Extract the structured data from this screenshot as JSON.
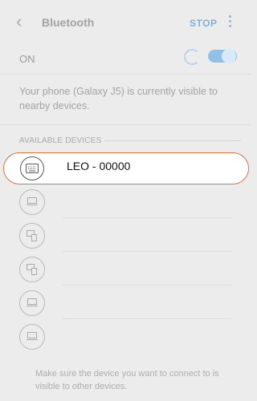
{
  "header": {
    "back_icon": "chevron-left-icon",
    "title": "Bluetooth",
    "stop_label": "STOP",
    "more_icon": "more-vertical-icon"
  },
  "status": {
    "label": "ON",
    "scanning": true,
    "toggle_on": true
  },
  "visibility_text": "Your phone (Galaxy J5) is currently visible to nearby devices.",
  "section_label": "AVAILABLE DEVICES",
  "devices": [
    {
      "name": "LEO - 00000",
      "icon": "keyboard-icon",
      "highlighted": true
    },
    {
      "name": "",
      "icon": "laptop-icon"
    },
    {
      "name": "",
      "icon": "devices-icon"
    },
    {
      "name": "",
      "icon": "devices-icon"
    },
    {
      "name": "",
      "icon": "laptop-icon"
    },
    {
      "name": "",
      "icon": "laptop-icon"
    }
  ],
  "footer_text": "Make sure the device you want to connect to is visible to other devices.",
  "colors": {
    "accent": "#7fb0dd",
    "highlight_border": "#d9754a",
    "background": "#ececec"
  }
}
